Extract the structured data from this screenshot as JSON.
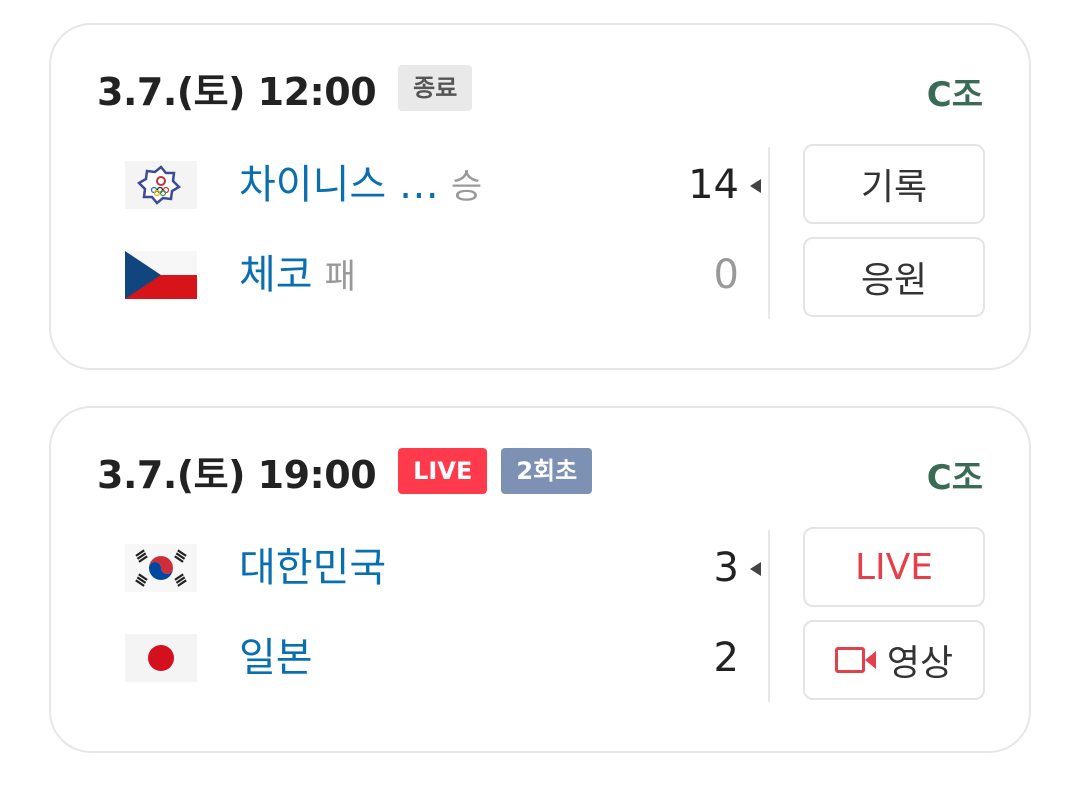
{
  "games": [
    {
      "datetime": "3.7.(토) 12:00",
      "status_badge": "종료",
      "group": "C조",
      "teams": [
        {
          "name": "차이니스 …",
          "result": "승",
          "score": "14",
          "flag": "chinese-taipei-flag-icon"
        },
        {
          "name": "체코",
          "result": "패",
          "score": "0",
          "flag": "czech-flag-icon"
        }
      ],
      "buttons": {
        "top": "기록",
        "bottom": "응원"
      }
    },
    {
      "datetime": "3.7.(토) 19:00",
      "status_badge": "LIVE",
      "inning_badge": "2회초",
      "group": "C조",
      "teams": [
        {
          "name": "대한민국",
          "result": "",
          "score": "3",
          "flag": "korea-flag-icon"
        },
        {
          "name": "일본",
          "result": "",
          "score": "2",
          "flag": "japan-flag-icon"
        }
      ],
      "buttons": {
        "top": "LIVE",
        "bottom": "영상"
      }
    }
  ],
  "colors": {
    "team_link": "#0a6fb0",
    "group": "#3a6b55",
    "live_red": "#ff3a4c",
    "inning_badge": "#7d91b4",
    "ended_badge": "#e9e9e9"
  }
}
